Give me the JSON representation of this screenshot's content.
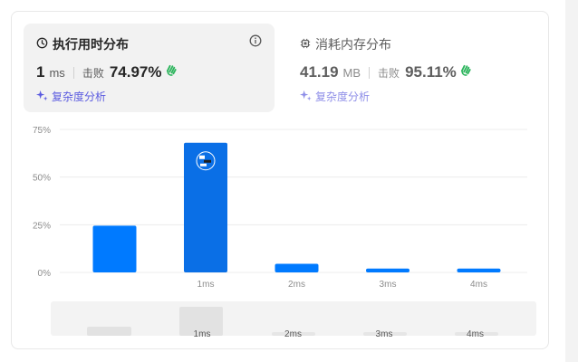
{
  "runtime": {
    "title": "执行用时分布",
    "value": "1",
    "unit": "ms",
    "beat_label": "击败",
    "percentile": "74.97%",
    "analyze_label": "复杂度分析"
  },
  "memory": {
    "title": "消耗内存分布",
    "value": "41.19",
    "unit": "MB",
    "beat_label": "击败",
    "percentile": "95.11%",
    "analyze_label": "复杂度分析"
  },
  "icons": {
    "clock": "clock-icon",
    "info": "info-icon",
    "chip": "chip-icon",
    "sparkle": "sparkle-icon",
    "hand": "clapping-hand-icon"
  },
  "colors": {
    "bar": "#007aff",
    "bar_active": "#0a6fe6",
    "accent": "#5a5ae0",
    "hand": "#2db55d"
  },
  "chart_data": {
    "type": "bar",
    "categories": [
      "",
      "1ms",
      "2ms",
      "3ms",
      "4ms"
    ],
    "values": [
      24.5,
      68,
      4.5,
      2,
      2
    ],
    "highlight_index": 1,
    "y_ticks": [
      "75%",
      "50%",
      "25%",
      "0%"
    ],
    "y_tick_values": [
      75,
      50,
      25,
      0
    ],
    "ylim": [
      0,
      75
    ],
    "grid": true
  },
  "overview": {
    "tick_labels": [
      "1ms",
      "2ms",
      "3ms",
      "4ms"
    ]
  }
}
